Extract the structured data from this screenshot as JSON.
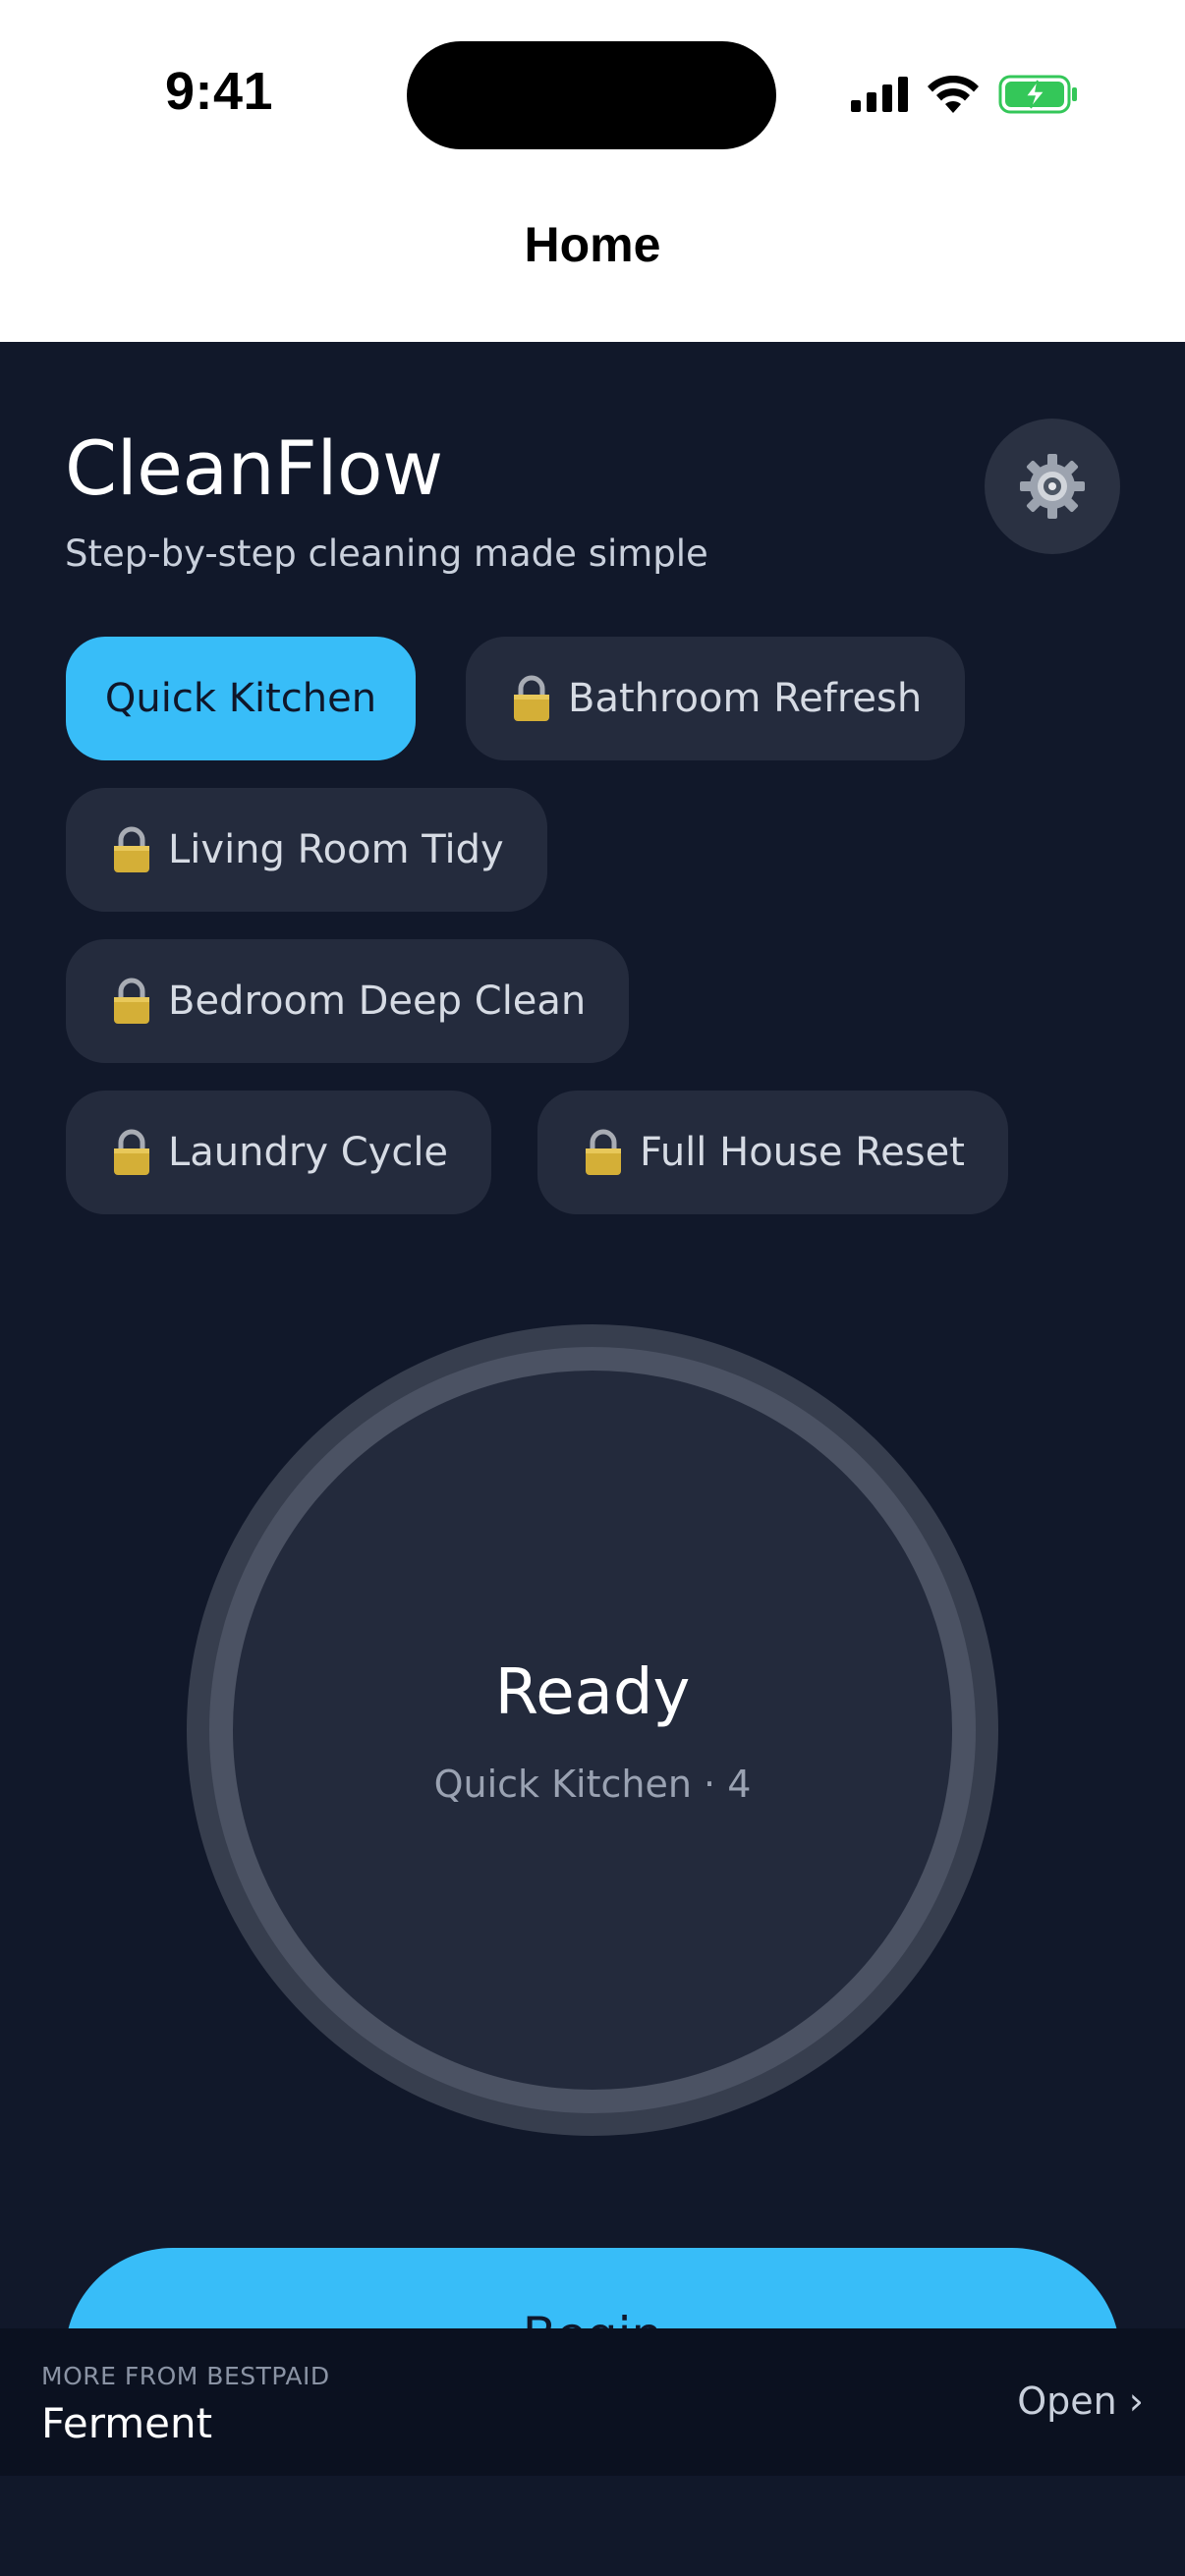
{
  "status_bar": {
    "time": "9:41"
  },
  "nav": {
    "title": "Home"
  },
  "app": {
    "title": "CleanFlow",
    "subtitle": "Step-by-step cleaning made simple",
    "settings_icon": "gear-icon"
  },
  "routines": [
    {
      "label": "Quick Kitchen",
      "locked": false,
      "selected": true
    },
    {
      "label": "Bathroom Refresh",
      "locked": true,
      "selected": false
    },
    {
      "label": "Living Room Tidy",
      "locked": true,
      "selected": false
    },
    {
      "label": "Bedroom Deep Clean",
      "locked": true,
      "selected": false
    },
    {
      "label": "Laundry Cycle",
      "locked": true,
      "selected": false
    },
    {
      "label": "Full House Reset",
      "locked": true,
      "selected": false
    }
  ],
  "timer": {
    "status": "Ready",
    "subtitle": "Quick Kitchen · 4"
  },
  "actions": {
    "begin_label": "Begin"
  },
  "promo": {
    "kicker": "MORE FROM BESTPAID",
    "app_name": "Ferment",
    "open_label": "Open ›"
  },
  "colors": {
    "background": "#11182A",
    "accent": "#38BDF8",
    "chip": "#242B3D",
    "battery": "#34C759"
  }
}
